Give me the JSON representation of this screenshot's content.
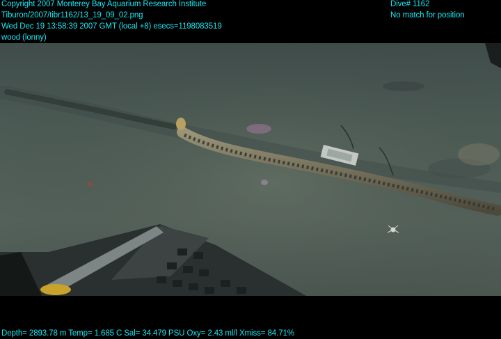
{
  "header": {
    "copyright": "Copyright 2007 Monterey Bay Aquarium Research Institute",
    "file_path": "Tiburon/2007/tibr1162/13_19_09_02.png",
    "datetime": "Wed Dec 19 13:58:39 2007 GMT (local +8)  esecs=1198083519",
    "annotation": "wood (lonny)",
    "dive": "Dive# 1162",
    "position_status": "No match for position"
  },
  "footer": {
    "telemetry": "Depth= 2893.78 m  Temp= 1.685 C  Sal= 34.479 PSU  Oxy= 2.43 ml/l  Xmiss= 84.71%"
  },
  "colors": {
    "overlay_text": "#19e6f2",
    "background": "#000000",
    "seafloor": "#4a5a52"
  }
}
